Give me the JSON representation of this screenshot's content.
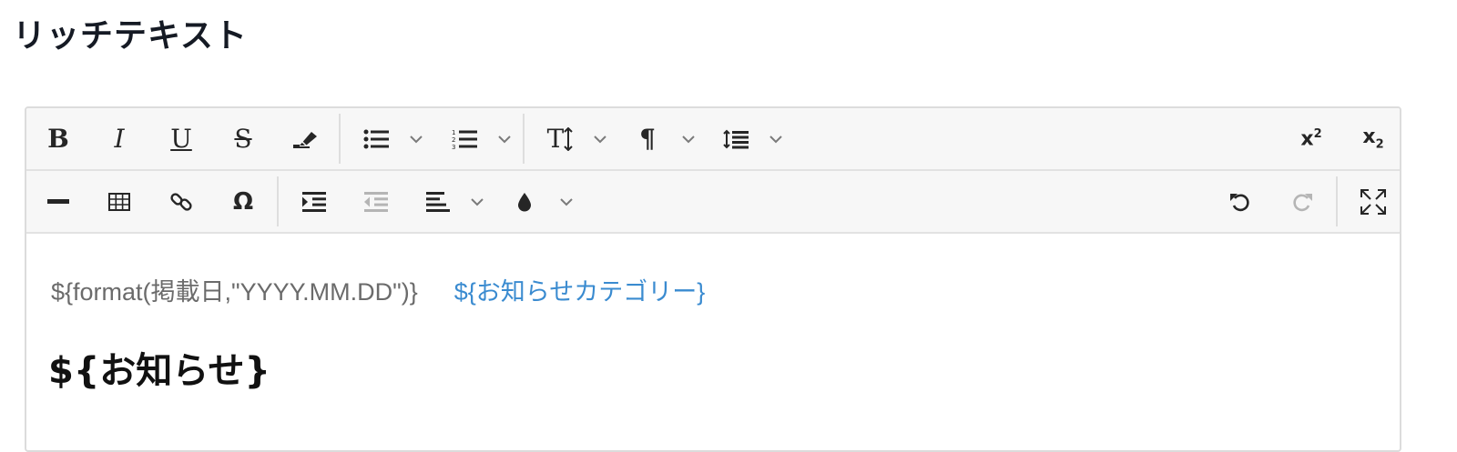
{
  "page": {
    "title": "リッチテキスト"
  },
  "toolbar": {
    "row1": [
      {
        "name": "bold-button",
        "icon": "bold-icon",
        "label": "B"
      },
      {
        "name": "italic-button",
        "icon": "italic-icon",
        "label": "I"
      },
      {
        "name": "underline-button",
        "icon": "underline-icon",
        "label": "U"
      },
      {
        "name": "strikethrough-button",
        "icon": "strikethrough-icon",
        "label": "S"
      },
      {
        "name": "clear-format-button",
        "icon": "eraser-icon"
      },
      {
        "name": "bullet-list-button",
        "icon": "bullet-list-icon",
        "has_dropdown": true
      },
      {
        "name": "numbered-list-button",
        "icon": "numbered-list-icon",
        "has_dropdown": true
      },
      {
        "name": "font-size-button",
        "icon": "font-size-icon",
        "label": "T",
        "has_dropdown": true
      },
      {
        "name": "paragraph-button",
        "icon": "pilcrow-icon",
        "label": "¶",
        "has_dropdown": true
      },
      {
        "name": "line-height-button",
        "icon": "line-height-icon",
        "has_dropdown": true
      },
      {
        "name": "superscript-button",
        "icon": "superscript-icon",
        "label": "x",
        "sup": "2"
      },
      {
        "name": "subscript-button",
        "icon": "subscript-icon",
        "label": "x",
        "sub": "2"
      }
    ],
    "row2": [
      {
        "name": "horizontal-rule-button",
        "icon": "horizontal-rule-icon"
      },
      {
        "name": "table-button",
        "icon": "table-icon"
      },
      {
        "name": "link-button",
        "icon": "link-icon"
      },
      {
        "name": "special-char-button",
        "icon": "omega-icon",
        "label": "Ω"
      },
      {
        "name": "indent-button",
        "icon": "indent-icon"
      },
      {
        "name": "outdent-button",
        "icon": "outdent-icon",
        "disabled": true
      },
      {
        "name": "align-button",
        "icon": "align-left-icon",
        "has_dropdown": true
      },
      {
        "name": "color-button",
        "icon": "droplet-icon",
        "has_dropdown": true
      },
      {
        "name": "undo-button",
        "icon": "undo-icon"
      },
      {
        "name": "redo-button",
        "icon": "redo-icon",
        "disabled": true
      },
      {
        "name": "fullscreen-button",
        "icon": "fullscreen-icon"
      }
    ]
  },
  "content": {
    "date_template": "${format(掲載日,\"YYYY.MM.DD\")}",
    "category_template": "${お知らせカテゴリー}",
    "headline_template": "${お知らせ}"
  },
  "colors": {
    "toolbar_bg": "#f7f7f7",
    "border": "#dcdcdc",
    "date_text": "#6b6b6b",
    "category_link": "#3a8bd0",
    "disabled_icon": "#b5b5b5"
  }
}
